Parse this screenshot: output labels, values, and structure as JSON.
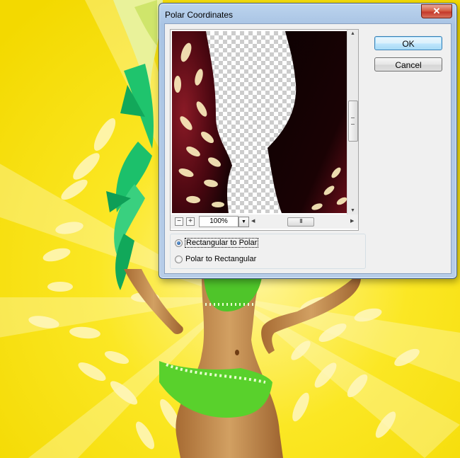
{
  "dialog": {
    "title": "Polar Coordinates",
    "close_symbol": "✕",
    "ok_label": "OK",
    "cancel_label": "Cancel",
    "zoom": {
      "minus_symbol": "−",
      "plus_symbol": "+",
      "value": "100%"
    },
    "scroll_grip": "III",
    "options": [
      {
        "label": "Rectangular to Polar",
        "selected": true
      },
      {
        "label": "Polar to Rectangular",
        "selected": false
      }
    ]
  },
  "colors": {
    "background_yellow": "#f7e10a",
    "preview_dark_red": "#5a0a14",
    "bokeh": "#fff7c0",
    "feathers_green": "#19c26a"
  },
  "icons": [
    "close-icon",
    "zoom-out-icon",
    "zoom-in-icon",
    "dropdown-arrow-icon",
    "scroll-up-arrow-icon",
    "scroll-down-arrow-icon",
    "scroll-left-arrow-icon",
    "scroll-right-arrow-icon"
  ]
}
